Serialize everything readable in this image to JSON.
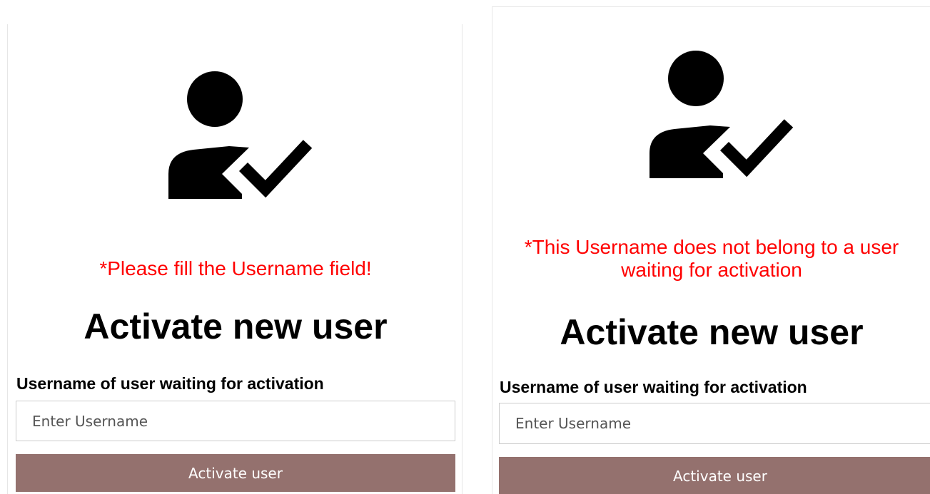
{
  "panels": [
    {
      "error_message": "*Please fill the Username field!",
      "title": "Activate new user",
      "field_label": "Username of user waiting for activation",
      "input_placeholder": "Enter Username",
      "input_value": "",
      "button_label": "Activate user"
    },
    {
      "error_message": "*This Username does not belong to a user waiting for activation",
      "title": "Activate new user",
      "field_label": "Username of user waiting for activation",
      "input_placeholder": "Enter Username",
      "input_value": "",
      "button_label": "Activate user"
    }
  ],
  "icons": {
    "user_check": "user-check-icon"
  },
  "colors": {
    "error": "#ff0000",
    "button_bg": "#94716e",
    "button_text": "#ffffff",
    "text": "#000000"
  }
}
